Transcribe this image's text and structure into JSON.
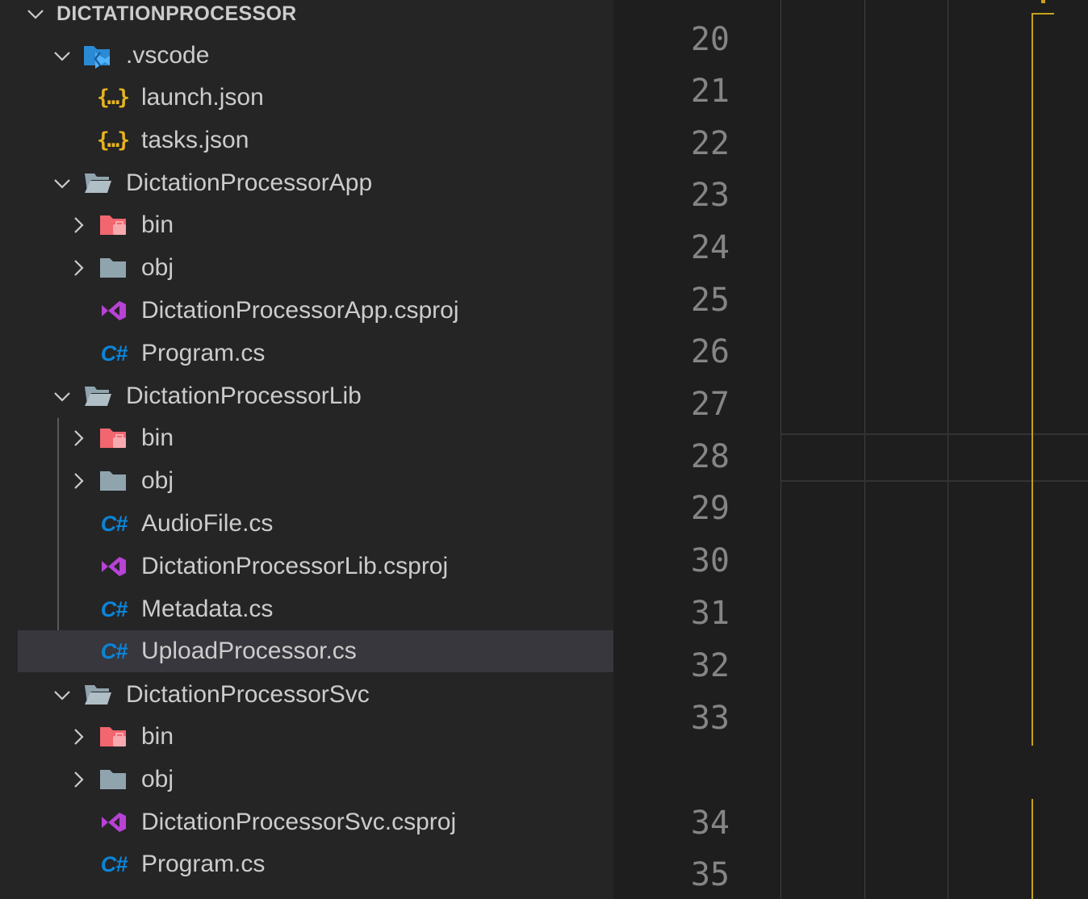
{
  "explorer": {
    "section_title": "DICTATIONPROCESSOR",
    "items": [
      {
        "label": ".vscode",
        "icon": "vscode-folder-icon"
      },
      {
        "label": "launch.json",
        "icon": "json-icon"
      },
      {
        "label": "tasks.json",
        "icon": "json-icon"
      },
      {
        "label": "DictationProcessorApp",
        "icon": "folder-open-icon"
      },
      {
        "label": "bin",
        "icon": "bin-folder-icon"
      },
      {
        "label": "obj",
        "icon": "folder-icon"
      },
      {
        "label": "DictationProcessorApp.csproj",
        "icon": "visual-studio-icon"
      },
      {
        "label": "Program.cs",
        "icon": "csharp-icon"
      },
      {
        "label": "DictationProcessorLib",
        "icon": "folder-open-icon"
      },
      {
        "label": "bin",
        "icon": "bin-folder-icon"
      },
      {
        "label": "obj",
        "icon": "folder-icon"
      },
      {
        "label": "AudioFile.cs",
        "icon": "csharp-icon"
      },
      {
        "label": "DictationProcessorLib.csproj",
        "icon": "visual-studio-icon"
      },
      {
        "label": "Metadata.cs",
        "icon": "csharp-icon"
      },
      {
        "label": "UploadProcessor.cs",
        "icon": "csharp-icon"
      },
      {
        "label": "DictationProcessorSvc",
        "icon": "folder-open-icon"
      },
      {
        "label": "bin",
        "icon": "bin-folder-icon"
      },
      {
        "label": "obj",
        "icon": "folder-icon"
      },
      {
        "label": "DictationProcessorSvc.csproj",
        "icon": "visual-studio-icon"
      },
      {
        "label": "Program.cs",
        "icon": "csharp-icon"
      }
    ],
    "csharp_glyph": "C#",
    "json_glyph": "{…}"
  },
  "editor": {
    "line_numbers": [
      "20",
      "21",
      "22",
      "23",
      "24",
      "25",
      "26",
      "27",
      "28",
      "29",
      "30",
      "31",
      "32",
      "33",
      "34",
      "35"
    ]
  },
  "colors": {
    "sidebar_bg": "#252526",
    "editor_bg": "#1e1e1e",
    "selection_bg": "#37373d",
    "text": "#cccccc",
    "line_number": "#858585",
    "csharp": "#0a85d9",
    "json": "#e8b51e",
    "csproj": "#b842d6",
    "bin_folder": "#f1666f",
    "folder": "#90a4ae",
    "bracket_guide": "#c8a218"
  }
}
